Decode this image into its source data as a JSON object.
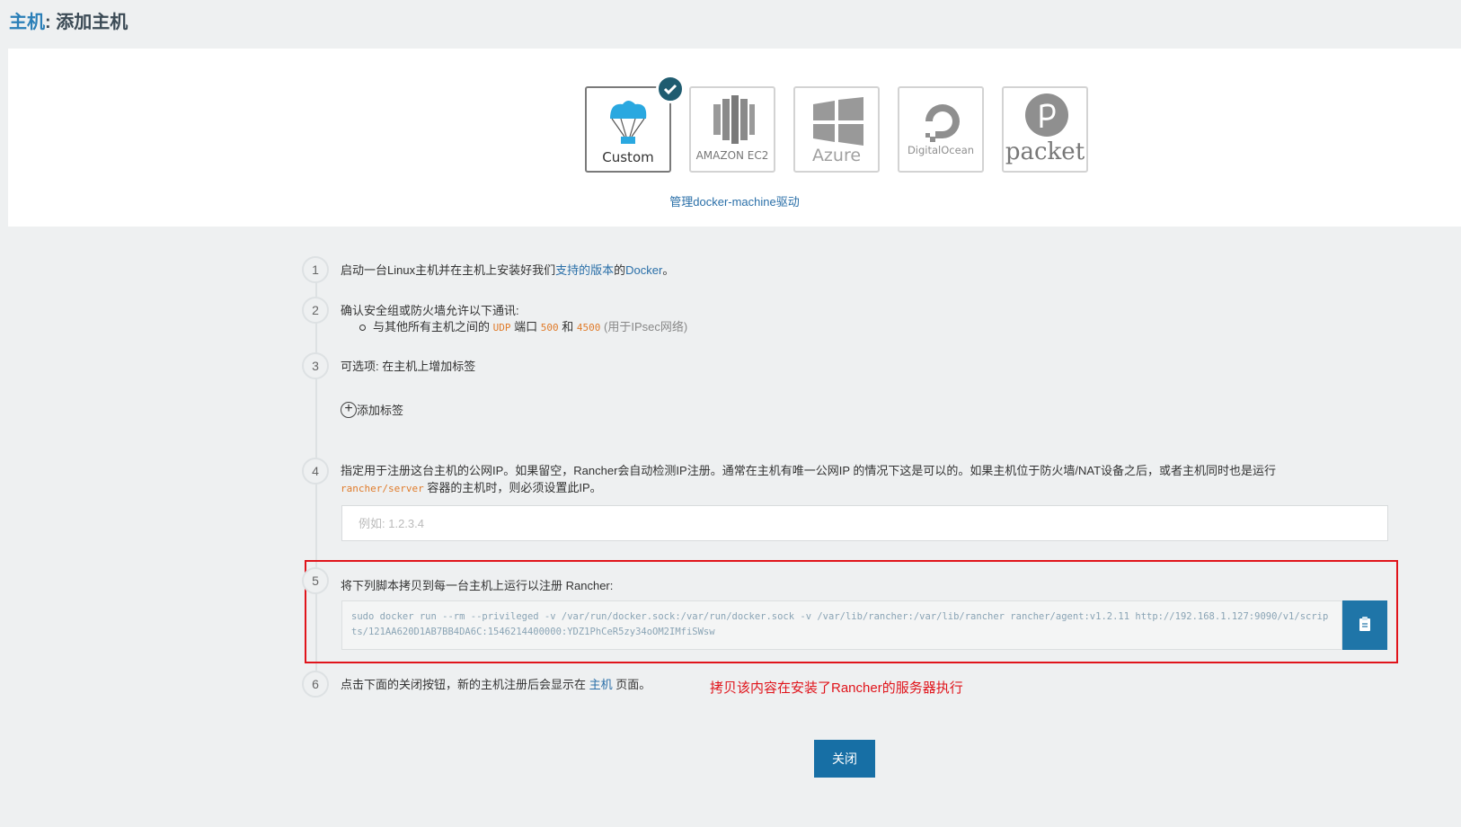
{
  "header": {
    "title_prefix": "主机",
    "title_suffix": ": 添加主机"
  },
  "drivers": {
    "items": [
      {
        "id": "custom",
        "label": "Custom",
        "selected": true
      },
      {
        "id": "amazon-ec2",
        "label": "AMAZON EC2",
        "selected": false
      },
      {
        "id": "azure",
        "label": "Azure",
        "selected": false
      },
      {
        "id": "digitalocean",
        "label": "DigitalOcean",
        "selected": false
      },
      {
        "id": "packet",
        "label": "packet",
        "selected": false
      }
    ],
    "manage_link": "管理docker-machine驱动"
  },
  "steps": {
    "s1": {
      "num": "1",
      "pre": "启动一台Linux主机并在主机上安装好我们",
      "link": "支持的版本",
      "mid": "的",
      "link2": "Docker",
      "post": "。"
    },
    "s2": {
      "num": "2",
      "text": "确认安全组或防火墙允许以下通讯:",
      "bullet_pre": "与其他所有主机之间的",
      "proto": "UDP",
      "port_word": "端口",
      "port1": "500",
      "and": "和",
      "port2": "4500",
      "note": "(用于IPsec网络)"
    },
    "s3": {
      "num": "3",
      "text": "可选项: 在主机上增加标签",
      "add_label": "添加标签"
    },
    "s4": {
      "num": "4",
      "line1": "指定用于注册这台主机的公网IP。如果留空，Rancher会自动检测IP注册。通常在主机有唯一公网IP 的情况下这是可以的。如果主机位于防火墙/NAT设备之后，或者主机同时也是运行",
      "code": "rancher/server",
      "line2": "容器的主机时，则必须设置此IP。",
      "placeholder": "例如: 1.2.3.4"
    },
    "s5": {
      "num": "5",
      "text": "将下列脚本拷贝到每一台主机上运行以注册 Rancher:",
      "command": "sudo docker run --rm --privileged -v /var/run/docker.sock:/var/run/docker.sock -v /var/lib/rancher:/var/lib/rancher rancher/agent:v1.2.11 http://192.168.1.127:9090/v1/scripts/121AA620D1AB7BB4DA6C:1546214400000:YDZ1PhCeR5zy34oOM2IMfiSWsw"
    },
    "s6": {
      "num": "6",
      "pre": "点击下面的关闭按钮，新的主机注册后会显示在",
      "link": "主机",
      "post": "页面。"
    }
  },
  "annotation": "拷贝该内容在安装了Rancher的服务器执行",
  "close_label": "关闭",
  "colors": {
    "accent": "#176fa5",
    "annotation": "#e0141b",
    "check": "#1f5c70"
  }
}
